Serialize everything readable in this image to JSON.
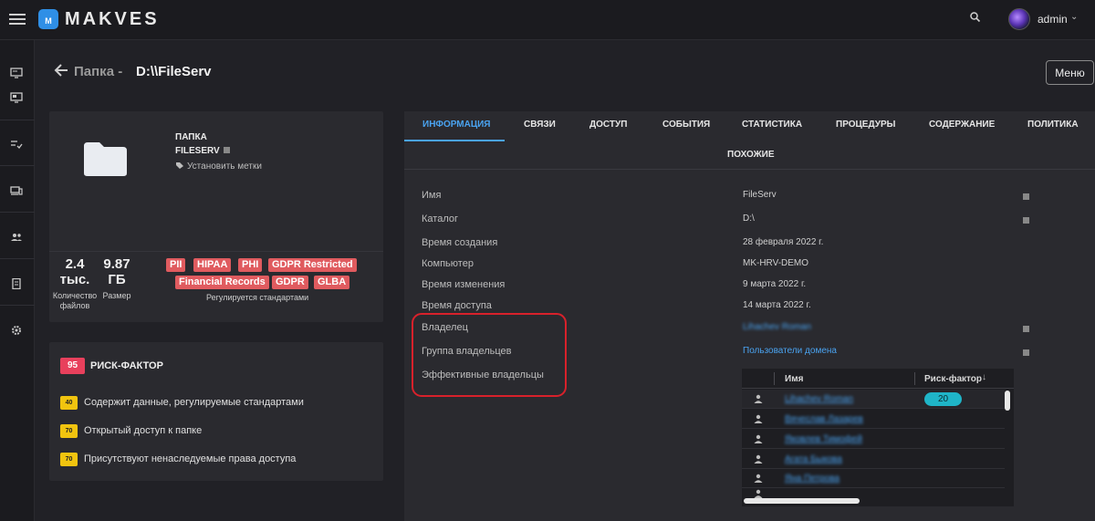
{
  "app": {
    "brand": "MAKVES",
    "logo_text": "M",
    "user": "admin"
  },
  "header": {
    "prefix": "Папка -",
    "path": "D:\\\\FileServ",
    "menu_label": "Меню"
  },
  "object_card": {
    "type": "ПАПКА",
    "name": "FILESERV",
    "set_labels": "Установить метки",
    "file_count_value": "2.4",
    "file_count_unit": "тыс.",
    "file_count_label": "Количество файлов",
    "size_value": "9.87",
    "size_unit": "ГБ",
    "size_label": "Размер",
    "tags": [
      "PII",
      "HIPAA",
      "PHI",
      "GDPR Restricted",
      "Financial Records",
      "GDPR",
      "GLBA"
    ],
    "tags_caption": "Регулируется стандартами"
  },
  "risk": {
    "score": "95",
    "title": "РИСК-ФАКТОР",
    "items": [
      {
        "score": "40",
        "text": "Содержит данные, регулируемые стандартами"
      },
      {
        "score": "70",
        "text": "Открытый доступ к папке"
      },
      {
        "score": "70",
        "text": "Присутствуют ненаследуемые права доступа"
      }
    ]
  },
  "tabs": [
    "ИНФОРМАЦИЯ",
    "СВЯЗИ",
    "ДОСТУП",
    "СОБЫТИЯ",
    "СТАТИСТИКА",
    "ПРОЦЕДУРЫ",
    "СОДЕРЖАНИЕ",
    "ПОЛИТИКА",
    "ПОХОЖИЕ"
  ],
  "active_tab": "ИНФОРМАЦИЯ",
  "properties": [
    {
      "label": "Имя",
      "value": "FileServ"
    },
    {
      "label": "Каталог",
      "value": "D:\\"
    },
    {
      "label": "Время создания",
      "value": "28 февраля 2022 г."
    },
    {
      "label": "Компьютер",
      "value": "MK-HRV-DEMO"
    },
    {
      "label": "Время изменения",
      "value": "9 марта 2022 г."
    },
    {
      "label": "Время доступа",
      "value": "14 марта 2022 г."
    },
    {
      "label": "Владелец",
      "value": "Lihachev Roman"
    },
    {
      "label": "Группа владельцев",
      "value": "Пользователи домена"
    },
    {
      "label": "Эффективные владельцы",
      "value": ""
    }
  ],
  "owners_grid": {
    "col_name": "Имя",
    "col_risk": "Риск-фактор",
    "rows": [
      {
        "name": "Lihachev Roman",
        "risk": "20"
      },
      {
        "name": "Вячеслав Лазарев",
        "risk": ""
      },
      {
        "name": "Яковлев Тимофей",
        "risk": ""
      },
      {
        "name": "Агата Быкова",
        "risk": ""
      },
      {
        "name": "Яна Петрова",
        "risk": ""
      }
    ]
  },
  "colors": {
    "accent": "#4aa3f0",
    "tag": "#e05b5f",
    "risk_main": "#e8405c",
    "risk_item": "#f1c40f",
    "highlight": "#d8212b"
  }
}
